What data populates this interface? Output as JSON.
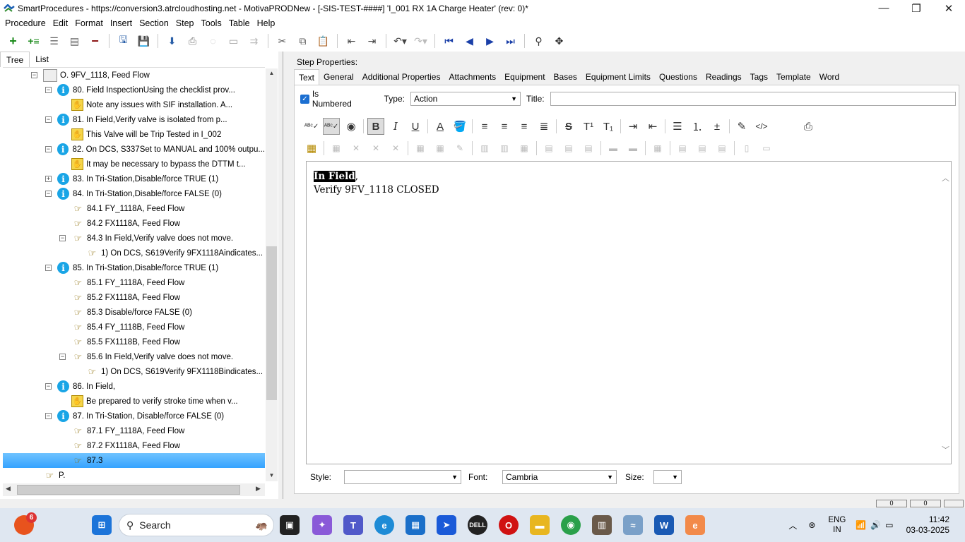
{
  "window": {
    "title": "SmartProcedures - https://conversion3.atrcloudhosting.net - MotivaPRODNew - [-SIS-TEST-####] 'I_001 RX 1A Charge Heater' (rev: 0)*",
    "minimize": "—",
    "maximize": "❐",
    "close": "✕"
  },
  "menu": [
    "Procedure",
    "Edit",
    "Format",
    "Insert",
    "Section",
    "Step",
    "Tools",
    "Table",
    "Help"
  ],
  "left_tabs": [
    "Tree",
    "List"
  ],
  "tree": [
    {
      "indent": 0,
      "exp": "−",
      "icon": "doc",
      "text": "O. 9FV_1118, Feed Flow"
    },
    {
      "indent": 1,
      "exp": "−",
      "icon": "info",
      "text": "80. Field InspectionUsing the checklist prov..."
    },
    {
      "indent": 2,
      "exp": "",
      "icon": "note",
      "text": "Note any issues with SIF installation. A..."
    },
    {
      "indent": 1,
      "exp": "−",
      "icon": "info",
      "text": "81. In Field,Verify valve is isolated from p..."
    },
    {
      "indent": 2,
      "exp": "",
      "icon": "note",
      "text": "This Valve will be Trip Tested in I_002"
    },
    {
      "indent": 1,
      "exp": "−",
      "icon": "info",
      "text": "82. On DCS, S337Set to MANUAL and 100% outpu..."
    },
    {
      "indent": 2,
      "exp": "",
      "icon": "note",
      "text": "It may be necessary to bypass the DTTM t..."
    },
    {
      "indent": 1,
      "exp": "+",
      "icon": "info",
      "text": "83. In Tri-Station,Disable/force TRUE (1)"
    },
    {
      "indent": 1,
      "exp": "−",
      "icon": "info",
      "text": "84. In Tri-Station,Disable/force FALSE (0)"
    },
    {
      "indent": 2,
      "exp": "",
      "icon": "hand",
      "text": "84.1 FY_1118A, Feed Flow"
    },
    {
      "indent": 2,
      "exp": "",
      "icon": "hand",
      "text": "84.2 FX1118A, Feed Flow"
    },
    {
      "indent": 2,
      "exp": "−",
      "icon": "hand",
      "text": "84.3 In Field,Verify valve does not move."
    },
    {
      "indent": 3,
      "exp": "",
      "icon": "hand",
      "text": "1) On DCS, S619Verify 9FX1118Aindicates..."
    },
    {
      "indent": 1,
      "exp": "−",
      "icon": "info",
      "text": "85. In Tri-Station,Disable/force TRUE (1)"
    },
    {
      "indent": 2,
      "exp": "",
      "icon": "hand",
      "text": "85.1 FY_1118A, Feed Flow"
    },
    {
      "indent": 2,
      "exp": "",
      "icon": "hand",
      "text": "85.2 FX1118A, Feed Flow"
    },
    {
      "indent": 2,
      "exp": "",
      "icon": "hand",
      "text": "85.3 Disable/force FALSE (0)"
    },
    {
      "indent": 2,
      "exp": "",
      "icon": "hand",
      "text": "85.4 FY_1118B, Feed Flow"
    },
    {
      "indent": 2,
      "exp": "",
      "icon": "hand",
      "text": "85.5 FX1118B, Feed Flow"
    },
    {
      "indent": 2,
      "exp": "−",
      "icon": "hand",
      "text": "85.6 In Field,Verify valve does not move."
    },
    {
      "indent": 3,
      "exp": "",
      "icon": "hand",
      "text": "1) On DCS, S619Verify 9FX1118Bindicates..."
    },
    {
      "indent": 1,
      "exp": "−",
      "icon": "info",
      "text": "86. In Field,"
    },
    {
      "indent": 2,
      "exp": "",
      "icon": "note",
      "text": "Be prepared to verify stroke time when v..."
    },
    {
      "indent": 1,
      "exp": "−",
      "icon": "info",
      "text": "87. In Tri-Station, Disable/force FALSE (0)"
    },
    {
      "indent": 2,
      "exp": "",
      "icon": "hand",
      "text": "87.1 FY_1118A, Feed Flow"
    },
    {
      "indent": 2,
      "exp": "",
      "icon": "hand",
      "text": "87.2 FX1118A, Feed Flow"
    },
    {
      "indent": 2,
      "exp": "",
      "icon": "hand",
      "text": "87.3",
      "selected": true
    },
    {
      "indent": 0,
      "exp": "",
      "icon": "hand",
      "text": "P."
    }
  ],
  "step_properties_label": "Step Properties:",
  "right_tabs": [
    "Text",
    "General",
    "Additional Properties",
    "Attachments",
    "Equipment",
    "Bases",
    "Equipment Limits",
    "Questions",
    "Readings",
    "Tags",
    "Template",
    "Word"
  ],
  "fields": {
    "is_numbered_label": "Is Numbered",
    "type_label": "Type:",
    "type_value": "Action",
    "title_label": "Title:"
  },
  "editor": {
    "highlighted": "In Field",
    "after_highlight": ",",
    "line2": "Verify 9FV_1118 CLOSED"
  },
  "bottom": {
    "style_label": "Style:",
    "font_label": "Font:",
    "font_value": "Cambria",
    "size_label": "Size:"
  },
  "status": {
    "box1": "0",
    "box2": "0"
  },
  "taskbar": {
    "search_placeholder": "Search",
    "badge": "6",
    "lang_line1": "ENG",
    "lang_line2": "IN",
    "time": "11:42",
    "date": "03-03-2025"
  },
  "colors": {
    "selection": "#35a3ff",
    "info_icon": "#19a5e6",
    "accent": "#1c6fd1"
  }
}
